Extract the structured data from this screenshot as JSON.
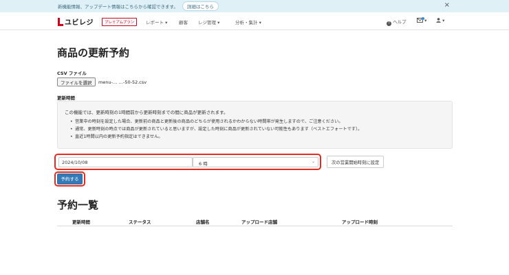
{
  "banner": {
    "text": "新機能情報、アップデート情報はこちらから確認できます。",
    "link": "詳細はこちら",
    "close": "×"
  },
  "navbar": {
    "logo_text": "ユビレジ",
    "premium_badge": "プレミアムプラン",
    "items": [
      "レポート ▾",
      "顧客",
      "レジ管理 ▾",
      "分析・集計 ▾"
    ],
    "help": "ヘルプ",
    "mail_caret": "▾",
    "user_caret": "▾"
  },
  "page": {
    "title": "商品の更新予約",
    "csv_label": "CSV ファイル",
    "file_button": "ファイルを選択",
    "file_name": "menu-… …-50-52.csv",
    "time_label": "更新時間",
    "info_lead": "この機能では、更新時刻の1時間前から更新時刻までの間に商品が更新されます。",
    "info_items": [
      "営業中の時刻を設定した場合、更新前の商品と更新後の商品のどちらが使用されるかわからない時間帯が発生しますので、ご注意ください。",
      "通常、更新時刻の時点では商品が更新されていると思いますが、設定した時刻に商品が更新されていない可能性もあります（ベストエフォートです）。",
      "直近1時間以内の更新予約指定はできません。"
    ],
    "date_value": "2024/10/08",
    "hour_value": "6 時",
    "next_open_button": "次の営業開始時刻に設定",
    "reserve_button": "予約する",
    "list_title": "予約一覧",
    "table_headers": [
      "更新時間",
      "ステータス",
      "店舗名",
      "アップロード店舗",
      "アップロード時刻"
    ]
  },
  "colors": {
    "highlight": "#e8291c",
    "primary": "#337ab7",
    "banner_bg": "#dff0f6",
    "brand": "#d0021b"
  }
}
